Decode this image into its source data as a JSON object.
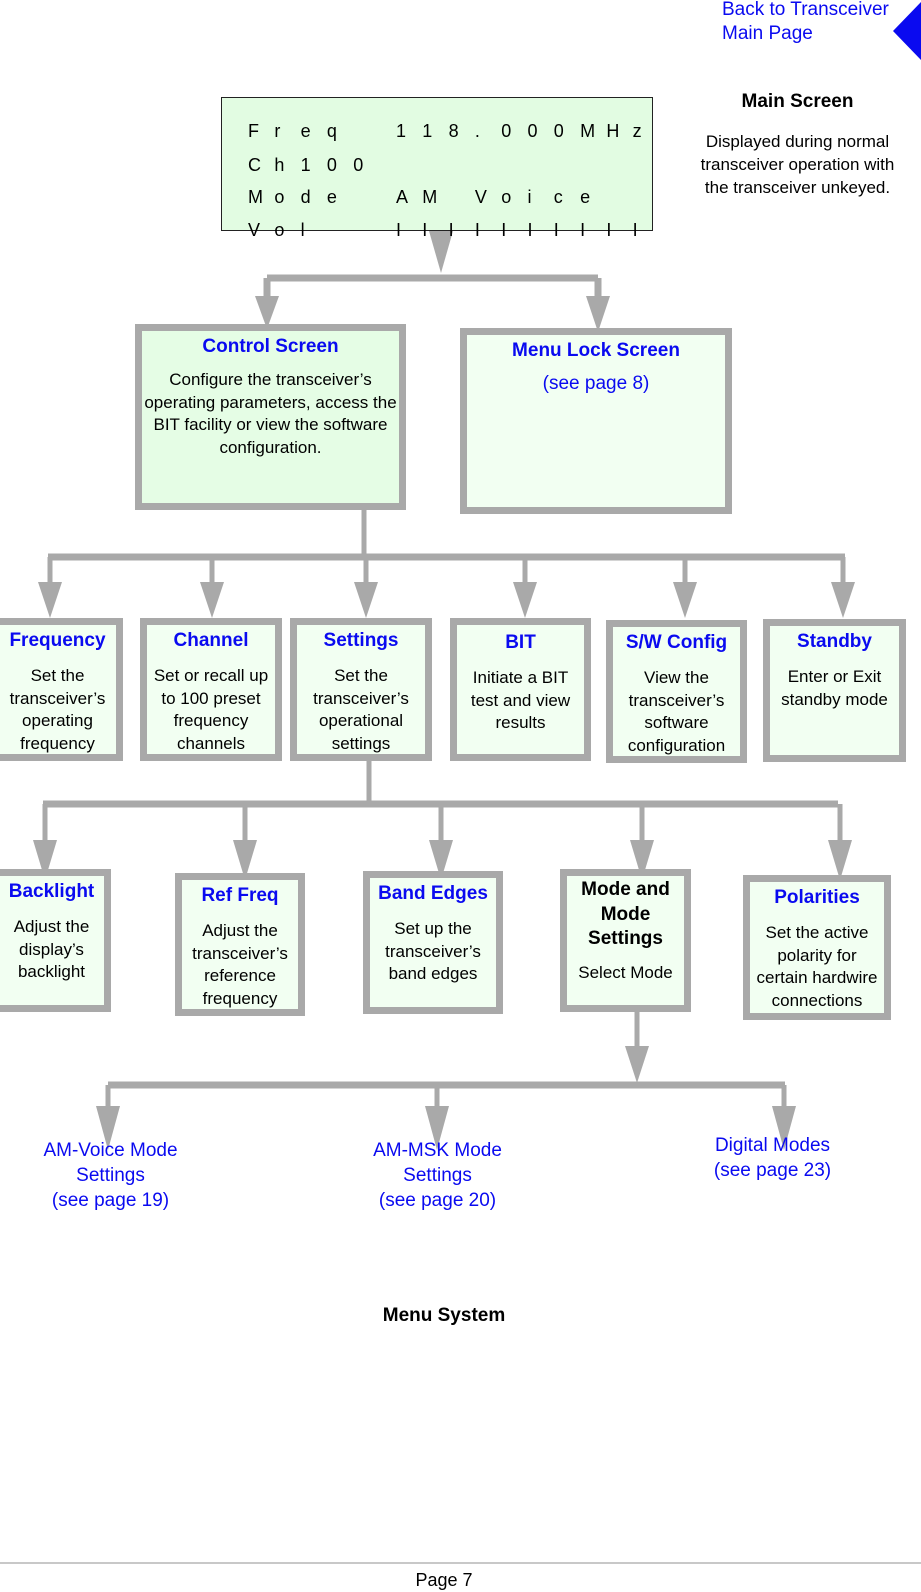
{
  "nav": {
    "back_link_line1": "Back to Transceiver",
    "back_link_line2": "Main Page",
    "back_icon": "triangle-left-icon",
    "accent_color": "#0a0af0"
  },
  "lcd": {
    "rows": [
      {
        "label": [
          "F",
          "r",
          "e",
          "q"
        ],
        "value": [
          "1",
          "1",
          "8",
          ".",
          "0",
          "0",
          "0",
          "M",
          "H",
          "z"
        ]
      },
      {
        "label": [
          "C",
          "h",
          "1",
          "0",
          "0"
        ],
        "value": []
      },
      {
        "label": [
          "M",
          "o",
          "d",
          "e"
        ],
        "value": [
          "A",
          "M",
          "",
          "V",
          "o",
          "i",
          "c",
          "e"
        ]
      },
      {
        "label": [
          "V",
          "o",
          "l"
        ],
        "value": [
          "I",
          "I",
          "I",
          "I",
          "I",
          "I",
          "I",
          "I",
          "I",
          "I"
        ]
      }
    ],
    "background_color": "#e2fce2"
  },
  "main_screen": {
    "title": "Main Screen",
    "description": "Displayed during normal transceiver operation with the transceiver unkeyed."
  },
  "level1": {
    "control_screen": {
      "title": "Control Screen",
      "description": "Configure the transceiver’s operating parameters, access the BIT facility or view the software configuration."
    },
    "menu_lock_screen": {
      "title": "Menu Lock Screen",
      "link": "(see page 8)"
    }
  },
  "level2": [
    {
      "title": "Frequency",
      "description": "Set the transceiver’s operating frequency"
    },
    {
      "title": "Channel",
      "description": "Set or recall up to 100 preset frequency channels"
    },
    {
      "title": "Settings",
      "description": "Set the transceiver’s operational settings"
    },
    {
      "title": "BIT",
      "description": "Initiate a BIT test and view results"
    },
    {
      "title": "S/W Config",
      "description": "View the transceiver’s software configuration"
    },
    {
      "title": "Standby",
      "description": "Enter or Exit standby mode"
    }
  ],
  "level3": [
    {
      "title": "Backlight",
      "description": "Adjust the display’s backlight"
    },
    {
      "title": "Ref Freq",
      "description": "Adjust the transceiver’s reference frequency"
    },
    {
      "title": "Band Edges",
      "description": "Set up the transceiver’s band edges"
    },
    {
      "title": "Mode and Mode Settings",
      "description": "Select Mode"
    },
    {
      "title": "Polarities",
      "description": "Set the active polarity for certain hardwire connections"
    }
  ],
  "level4": [
    {
      "line1": "AM-Voice Mode",
      "line2": "Settings",
      "line3": "(see page 19)"
    },
    {
      "line1": "AM-MSK Mode",
      "line2": "Settings",
      "line3": "(see page 20)"
    },
    {
      "line1": "Digital Modes",
      "line2": "(see page 23)",
      "line3": ""
    }
  ],
  "caption": "Menu System",
  "footer": {
    "page_label": "Page 7"
  },
  "connector_color": "#a9a9a9"
}
